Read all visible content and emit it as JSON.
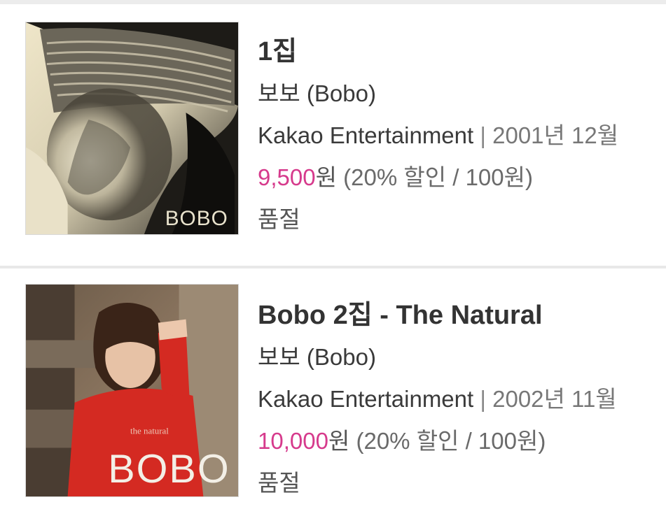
{
  "albums": [
    {
      "title": "1집",
      "artist": "보보 (Bobo)",
      "label": "Kakao Entertainment",
      "separator": "|",
      "release": "2001년 12월",
      "price": "9,500",
      "currency": "원",
      "discount": "(20% 할인 / 100원)",
      "status": "품절",
      "cover_text": "BOBO"
    },
    {
      "title": "Bobo 2집 - The Natural",
      "artist": "보보 (Bobo)",
      "label": "Kakao Entertainment",
      "separator": "|",
      "release": "2002년 11월",
      "price": "10,000",
      "currency": "원",
      "discount": "(20% 할인 / 100원)",
      "status": "품절",
      "cover_text": "BOBO",
      "cover_subtext": "the natural"
    }
  ],
  "colors": {
    "price": "#d63a8c",
    "text": "#333333",
    "muted": "#777777",
    "divider": "#e8e8e8"
  }
}
